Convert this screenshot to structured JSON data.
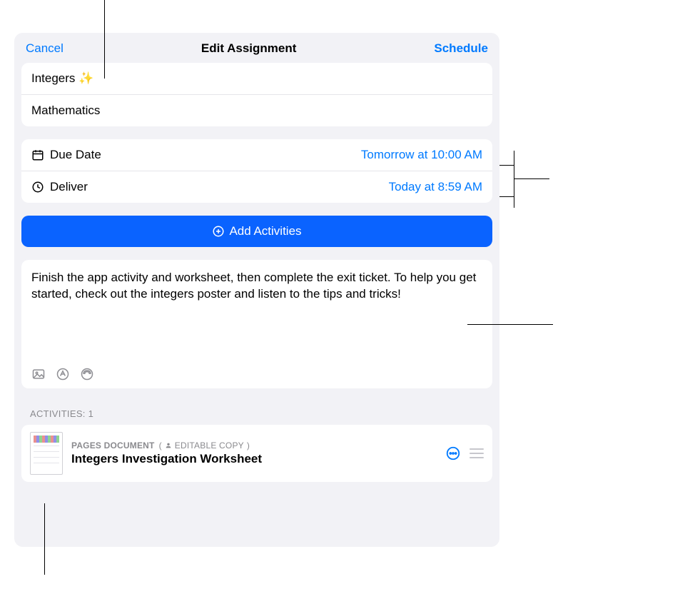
{
  "nav": {
    "cancel": "Cancel",
    "title": "Edit Assignment",
    "schedule": "Schedule"
  },
  "assignment": {
    "name": "Integers ✨",
    "class": "Mathematics"
  },
  "schedule": {
    "due_label": "Due Date",
    "due_value": "Tomorrow at 10:00 AM",
    "deliver_label": "Deliver",
    "deliver_value": "Today at 8:59 AM"
  },
  "add_activities_label": "Add Activities",
  "description": "Finish the app activity and worksheet, then complete the exit ticket. To help you get started, check out the integers poster and listen to the tips and tricks!",
  "activities_header": "ACTIVITIES: 1",
  "activity": {
    "type": "PAGES DOCUMENT",
    "badge": "EDITABLE COPY",
    "title": "Integers Investigation Worksheet"
  }
}
